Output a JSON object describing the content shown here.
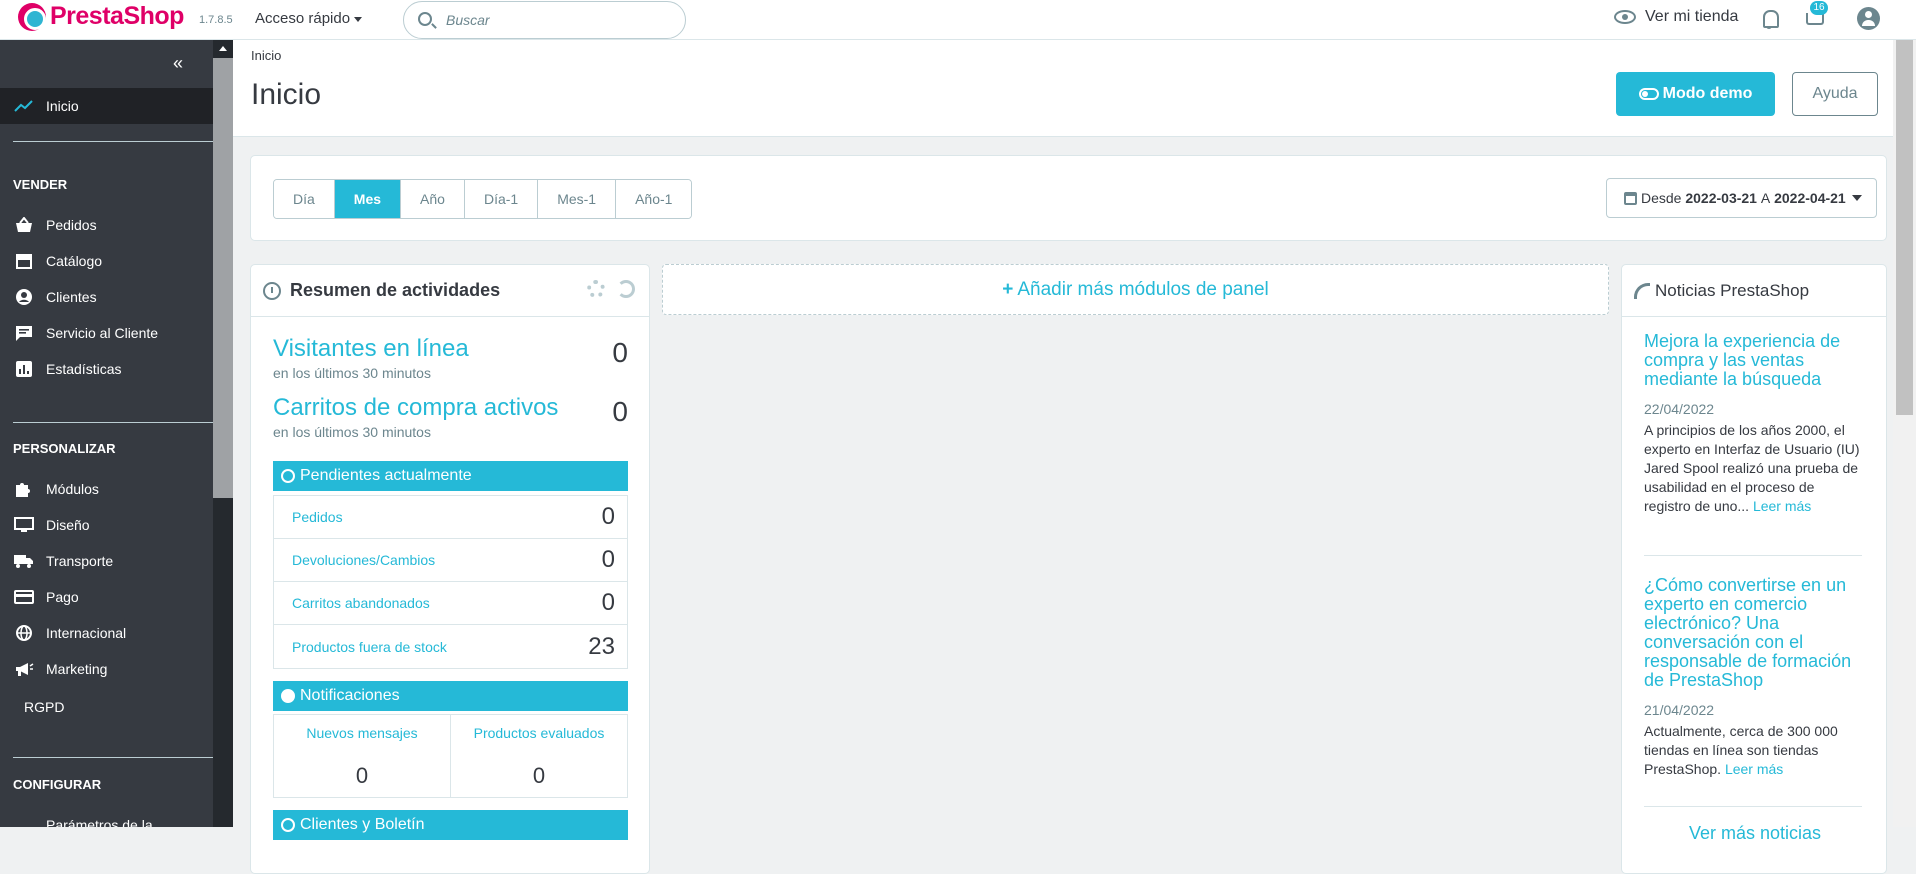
{
  "topbar": {
    "logo_text": "PrestaShop",
    "version": "1.7.8.5",
    "quick_access": "Acceso rápido",
    "search_placeholder": "Buscar",
    "view_shop": "Ver mi tienda",
    "cart_badge": "16",
    "icons": [
      "prestashop-logo",
      "eye-icon",
      "bell-icon",
      "cart-icon",
      "user-icon",
      "search-icon"
    ]
  },
  "sidebar": {
    "collapse_label": "«",
    "home": "Inicio",
    "sections": [
      {
        "heading": "VENDER",
        "items": [
          "Pedidos",
          "Catálogo",
          "Clientes",
          "Servicio al Cliente",
          "Estadísticas"
        ]
      },
      {
        "heading": "PERSONALIZAR",
        "items": [
          "Módulos",
          "Diseño",
          "Transporte",
          "Pago",
          "Internacional",
          "Marketing",
          "RGPD"
        ]
      },
      {
        "heading": "CONFIGURAR",
        "items": [
          "Parámetros de la"
        ]
      }
    ]
  },
  "header": {
    "breadcrumb": "Inicio",
    "title": "Inicio",
    "demo_button": "Modo demo",
    "help_button": "Ayuda"
  },
  "period": {
    "tabs": [
      "Día",
      "Mes",
      "Año",
      "Día-1",
      "Mes-1",
      "Año-1"
    ],
    "active_tab": "Mes",
    "from_label": "Desde",
    "from_date": "2022-03-21",
    "to_label": "A",
    "to_date": "2022-04-21"
  },
  "activity": {
    "title": "Resumen de actividades",
    "visitors_label": "Visitantes en línea",
    "visitors_sub": "en los últimos 30 minutos",
    "visitors_value": "0",
    "carts_label": "Carritos de compra activos",
    "carts_sub": "en los últimos 30 minutos",
    "carts_value": "0",
    "pending_title": "Pendientes actualmente",
    "pending": [
      {
        "label": "Pedidos",
        "value": "0"
      },
      {
        "label": "Devoluciones/Cambios",
        "value": "0"
      },
      {
        "label": "Carritos abandonados",
        "value": "0"
      },
      {
        "label": "Productos fuera de stock",
        "value": "23"
      }
    ],
    "notifications_title": "Notificaciones",
    "notifications": [
      {
        "label": "Nuevos mensajes",
        "value": "0"
      },
      {
        "label": "Productos evaluados",
        "value": "0"
      }
    ],
    "customers_title": "Clientes y Boletín"
  },
  "dashboard": {
    "add_modules": "Añadir más módulos de panel"
  },
  "news": {
    "title": "Noticias PrestaShop",
    "items": [
      {
        "title": "Mejora la experiencia de compra y las ventas mediante la búsqueda",
        "date": "22/04/2022",
        "excerpt": "A principios de los años 2000, el experto en Interfaz de Usuario (IU) Jared Spool realizó una prueba de usabilidad en el proceso de registro de uno...",
        "more": "Leer más"
      },
      {
        "title": "¿Cómo convertirse en un experto en comercio electrónico? Una conversación con el responsable de formación de PrestaShop",
        "date": "21/04/2022",
        "excerpt": "Actualmente, cerca de 300 000 tiendas en línea son tiendas PrestaShop.",
        "more": "Leer más"
      }
    ],
    "more_news": "Ver más noticias"
  }
}
